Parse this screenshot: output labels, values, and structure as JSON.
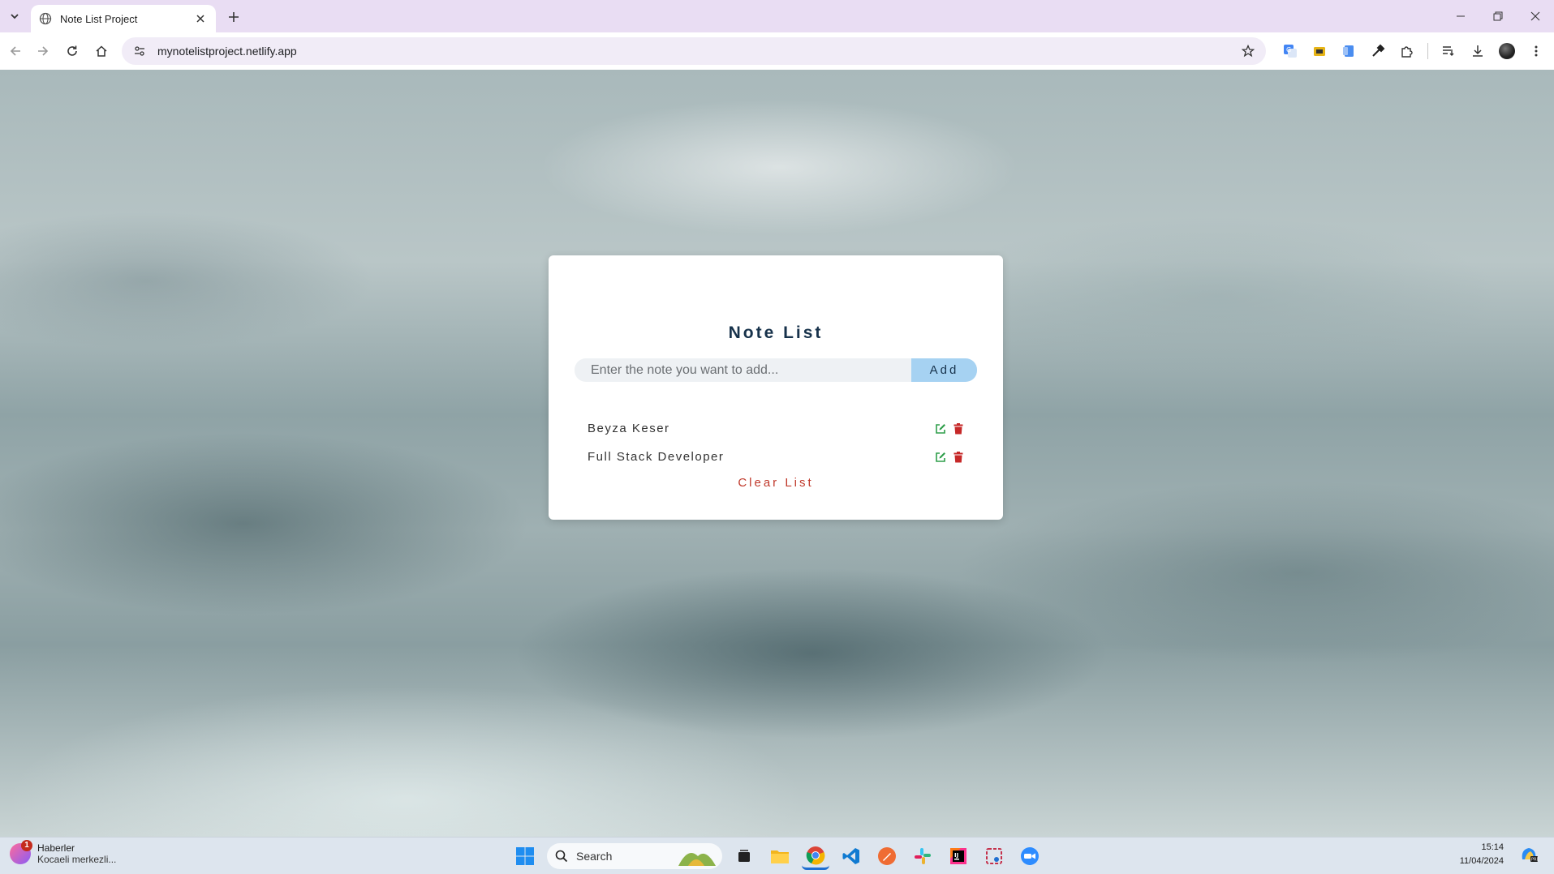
{
  "browser": {
    "tab_title": "Note List Project",
    "url": "mynotelistproject.netlify.app"
  },
  "app": {
    "title": "Note List",
    "input_placeholder": "Enter the note you want to add...",
    "add_label": "Add",
    "notes": [
      {
        "text": "Beyza Keser"
      },
      {
        "text": "Full Stack Developer"
      }
    ],
    "clear_label": "Clear List",
    "colors": {
      "title": "#17324b",
      "add_button": "#a6d2f2",
      "edit_icon": "#2e9e4a",
      "delete_icon": "#c62828",
      "clear": "#c0392b"
    }
  },
  "taskbar": {
    "widget_title": "Haberler",
    "widget_subtitle": "Kocaeli merkezli...",
    "widget_badge": "1",
    "search_label": "Search",
    "time": "15:14",
    "date": "11/04/2024",
    "apps": [
      "windows-start-icon",
      "task-view-icon",
      "file-explorer-icon",
      "chrome-icon",
      "vscode-icon",
      "postman-icon",
      "slack-icon",
      "intellij-icon",
      "snipping-tool-icon",
      "zoom-icon"
    ]
  }
}
